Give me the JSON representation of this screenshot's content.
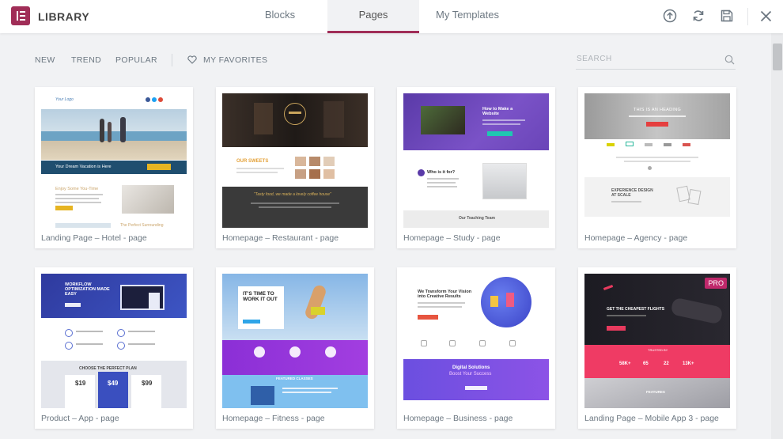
{
  "header": {
    "brand": "LIBRARY",
    "tabs": [
      {
        "label": "Blocks",
        "active": false
      },
      {
        "label": "Pages",
        "active": true
      },
      {
        "label": "My Templates",
        "active": false
      }
    ],
    "icons": [
      "upload-icon",
      "sync-icon",
      "save-icon",
      "close-icon"
    ]
  },
  "filters": {
    "items": [
      "NEW",
      "TREND",
      "POPULAR"
    ],
    "favorites": "MY FAVORITES",
    "search_placeholder": "SEARCH"
  },
  "cards": [
    {
      "title": "Landing Page – Hotel - page",
      "pro": false
    },
    {
      "title": "Homepage – Restaurant - page",
      "pro": false
    },
    {
      "title": "Homepage – Study - page",
      "pro": false
    },
    {
      "title": "Homepage – Agency - page",
      "pro": false
    },
    {
      "title": "Product – App - page",
      "pro": false
    },
    {
      "title": "Homepage – Fitness - page",
      "pro": false
    },
    {
      "title": "Homepage – Business - page",
      "pro": false
    },
    {
      "title": "Landing Page – Mobile App 3 - page",
      "pro": true,
      "badge": "PRO"
    }
  ],
  "thumb_texts": {
    "hotel_logo": "Your Logo",
    "hotel_banner": "Your Dream Vacation is Here",
    "hotel_sub": "Enjoy Some You-Time",
    "hotel_sub2": "The Perfect Surrounding",
    "rest_section": "OUR SWEETS",
    "rest_quote": "\"Tasty food, we made a lovely coffee house\"",
    "study_heading": "How to Make a Website",
    "study_who": "Who is it for?",
    "study_team": "Our Teaching Team",
    "agency_heading": "THIS IS AN HEADING",
    "agency_exp": "EXPERIENCE DESIGN AT SCALE",
    "app_heading": "WORKFLOW OPTIMIZATION MADE EASY",
    "app_plan": "CHOOSE THE PERFECT PLAN",
    "app_prices": [
      "$19",
      "$49",
      "$99"
    ],
    "fit_heading": "IT'S TIME TO WORK IT OUT",
    "fit_classes": "FEATURED CLASSES",
    "biz_heading": "We Transform Your Vision into Creative Results",
    "biz_digital": "Digital Solutions",
    "biz_boost": "Boost Your Success",
    "mob_heading": "GET THE CHEAPEST FLIGHTS",
    "mob_stats": [
      "58K+",
      "65",
      "22",
      "13K+"
    ],
    "mob_trusted": "TRUSTED BY",
    "mob_features": "FEATURES"
  },
  "colors": {
    "accent": "#a02d57",
    "background": "#f1f2f4",
    "pro_badge": "#c0286b"
  }
}
